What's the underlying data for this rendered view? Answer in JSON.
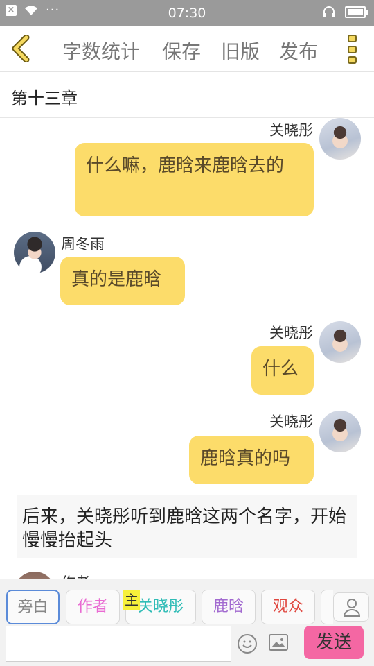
{
  "status_bar": {
    "time": "07:30",
    "dots": "···"
  },
  "toolbar": {
    "items": [
      "字数统计",
      "保存",
      "旧版",
      "发布"
    ]
  },
  "chapter": {
    "title": "第十三章"
  },
  "messages": [
    {
      "side": "right",
      "name": "关晓彤",
      "text": "什么嘛，鹿晗来鹿晗去的"
    },
    {
      "side": "left",
      "name": "周冬雨",
      "text": "真的是鹿晗"
    },
    {
      "side": "right",
      "name": "关晓彤",
      "text": "什么"
    },
    {
      "side": "right",
      "name": "关晓彤",
      "text": "鹿晗真的吗"
    }
  ],
  "narration": "后来，关晓彤听到鹿晗这两个名字，开始慢慢抬起头",
  "partial_name": "作者",
  "roles": {
    "host_badge": "主",
    "items": [
      {
        "label": "旁白",
        "color": "#888888"
      },
      {
        "label": "作者",
        "color": "#e96ad2"
      },
      {
        "label": "关晓彤",
        "color": "#2fbcb6"
      },
      {
        "label": "鹿晗",
        "color": "#a26ad0"
      },
      {
        "label": "观众",
        "color": "#e0473f"
      }
    ]
  },
  "input": {
    "placeholder": "",
    "value": ""
  },
  "send_label": "发送"
}
